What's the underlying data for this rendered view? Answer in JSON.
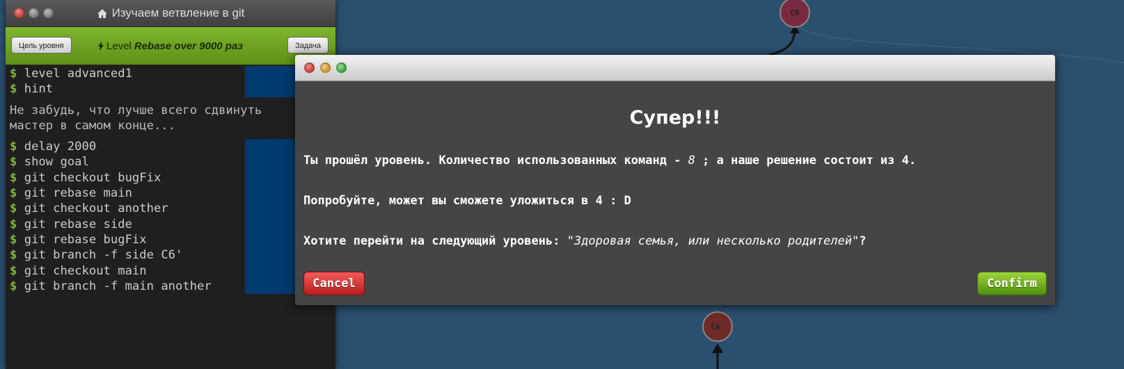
{
  "terminal": {
    "title": "Изучаем ветвление в git",
    "goal_button": "Цель уровня",
    "task_button": "Задача",
    "level_prefix": "Level",
    "level_name": "Rebase over 9000 раз",
    "history_top": [
      "level advanced1",
      "hint"
    ],
    "hint": "Не забудь, что лучше всего сдвинуть мастер в самом конце...",
    "history_bottom": [
      "delay 2000",
      "show goal",
      "git checkout bugFix",
      "git rebase main",
      "git checkout another",
      "git rebase side",
      "git rebase bugFix",
      "git branch -f side C6'",
      "git checkout main",
      "git branch -f main another"
    ],
    "prompt_symbol": "$"
  },
  "modal": {
    "heading": "Супер!!!",
    "line1_a": "Ты прошёл уровень. Количество использованных команд - ",
    "line1_count": "8",
    "line1_b": " ; а наше решение состоит из 4.",
    "line2": "Попробуйте, может вы сможете уложиться в 4 : D",
    "line3_a": "Хотите перейти на следующий уровень: ",
    "line3_level": "\"Здоровая семья, или несколько родителей\"",
    "line3_b": "?",
    "cancel_label": "Cancel",
    "confirm_label": "Confirm"
  },
  "graph": {
    "nodes": [
      {
        "label": "C0",
        "color": "#7a2a40"
      },
      {
        "label": "C4'",
        "color": "#6e2a28"
      }
    ]
  },
  "colors": {
    "background": "#2b4f6e",
    "level_bar": "#6fa022",
    "prompt": "#7cba2f",
    "cancel": "#d43030",
    "confirm": "#6aad1e"
  }
}
